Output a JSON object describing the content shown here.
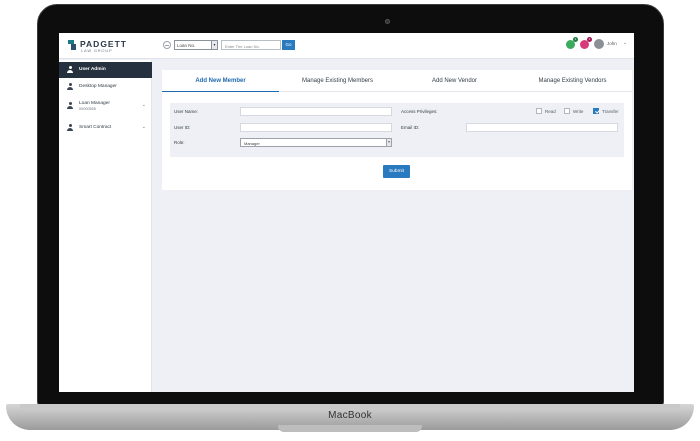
{
  "device": {
    "brand": "MacBook"
  },
  "topbar": {
    "logo_name": "PADGETT",
    "logo_sub": "LAW GROUP",
    "loan_select_value": "Loan No.",
    "loan_input_placeholder": "Enter The Loan No.",
    "go_label": "Go",
    "notif_1_count": "1",
    "notif_2_count": "1",
    "user_name": "John",
    "user_caret": "⌄"
  },
  "sidebar": {
    "items": [
      {
        "label": "User Admin",
        "sub": "",
        "chevron": ""
      },
      {
        "label": "Desktop Manager",
        "sub": "",
        "chevron": ""
      },
      {
        "label": "Loan Manager",
        "sub": "00000555",
        "chevron": "⌄"
      },
      {
        "label": "Smart Contract",
        "sub": "",
        "chevron": "⌄"
      }
    ]
  },
  "tabs": [
    {
      "label": "Add New Member"
    },
    {
      "label": "Manage Existing Members"
    },
    {
      "label": "Add New Vendor"
    },
    {
      "label": "Manage Existing Vendors"
    }
  ],
  "form": {
    "user_name_label": "User Name:",
    "user_id_label": "User ID:",
    "role_label": "Role:",
    "role_value": "Manager",
    "access_label": "Access Privileges:",
    "email_label": "Email ID:",
    "checkboxes": [
      {
        "label": "Read",
        "checked": false
      },
      {
        "label": "Write",
        "checked": false
      },
      {
        "label": "Transfer",
        "checked": true
      }
    ],
    "submit_label": "Submit",
    "caret": "▾"
  },
  "colors": {
    "accent": "#2a7abf",
    "sidebar_active": "#263140",
    "screen_bg": "#eef0f5"
  }
}
